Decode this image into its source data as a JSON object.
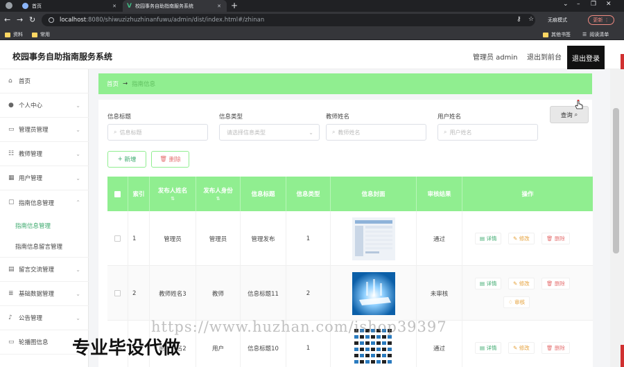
{
  "browser": {
    "tabs": [
      {
        "label": "首页",
        "active": false
      },
      {
        "label": "校园事务自助指南服务系统",
        "active": true
      }
    ],
    "url_host": "localhost",
    "url_path": ":8080/shiwuzizhuzhinanfuwu/admin/dist/index.html#/zhinan",
    "incognito_label": "无痕模式",
    "update_label": "更新",
    "bookmarks": [
      "资料",
      "常用"
    ],
    "bookmarks_right": [
      "其他书签",
      "阅读清单"
    ]
  },
  "header": {
    "site_title": "校园事务自助指南服务系统",
    "user_label": "管理员 admin",
    "front_link": "退出到前台",
    "logout_label": "退出登录"
  },
  "sidebar": {
    "items": [
      {
        "label": "首页",
        "icon": "home-icon"
      },
      {
        "label": "个人中心",
        "icon": "user-icon"
      },
      {
        "label": "管理员管理",
        "icon": "id-card-icon"
      },
      {
        "label": "教师管理",
        "icon": "sliders-icon"
      },
      {
        "label": "用户管理",
        "icon": "grid-icon"
      },
      {
        "label": "指南信息管理",
        "icon": "chat-icon"
      },
      {
        "label": "留言交流管理",
        "icon": "clipboard-icon"
      },
      {
        "label": "基础数据管理",
        "icon": "list-icon"
      },
      {
        "label": "公告管理",
        "icon": "mic-icon"
      },
      {
        "label": "轮播图信息",
        "icon": "monitor-icon"
      }
    ],
    "sub_items": [
      {
        "label": "指南信息管理",
        "active": true
      },
      {
        "label": "指南信息留言管理",
        "active": false
      }
    ]
  },
  "breadcrumb": {
    "home": "首页",
    "arrow": "→",
    "current": "指南信息"
  },
  "filters": [
    {
      "label": "信息标题",
      "placeholder": "信息标题",
      "type": "input"
    },
    {
      "label": "信息类型",
      "placeholder": "请选择信息类型",
      "type": "select"
    },
    {
      "label": "教师姓名",
      "placeholder": "教师姓名",
      "type": "input"
    },
    {
      "label": "用户姓名",
      "placeholder": "用户姓名",
      "type": "input"
    }
  ],
  "actions": {
    "search": "查询",
    "add": "新增",
    "delete": "删除"
  },
  "table": {
    "columns": [
      "索引",
      "发布人姓名",
      "发布人身份",
      "信息标题",
      "信息类型",
      "信息封面",
      "审核结果",
      "操作"
    ],
    "rows": [
      {
        "index": "1",
        "publisher_name": "管理员",
        "publisher_role": "管理员",
        "title": "管理发布",
        "type": "1",
        "audit": "通过",
        "ops": [
          "详情",
          "修改",
          "删除"
        ]
      },
      {
        "index": "2",
        "publisher_name": "教师姓名3",
        "publisher_role": "教师",
        "title": "信息标题11",
        "type": "2",
        "audit": "未审核",
        "ops": [
          "详情",
          "修改",
          "删除",
          "审核"
        ]
      },
      {
        "index": "3",
        "publisher_name": "用户姓名2",
        "publisher_role": "用户",
        "title": "信息标题10",
        "type": "1",
        "audit": "通过",
        "ops": [
          "详情",
          "修改",
          "删除"
        ]
      }
    ]
  },
  "overlay": {
    "watermark": "https://www.huzhan.com/ishop39397",
    "promo": "专业毕设代做"
  },
  "colors": {
    "accent": "#90ee90",
    "text_green": "#3aa86b",
    "danger": "#e57373",
    "warning": "#e6a23c"
  }
}
